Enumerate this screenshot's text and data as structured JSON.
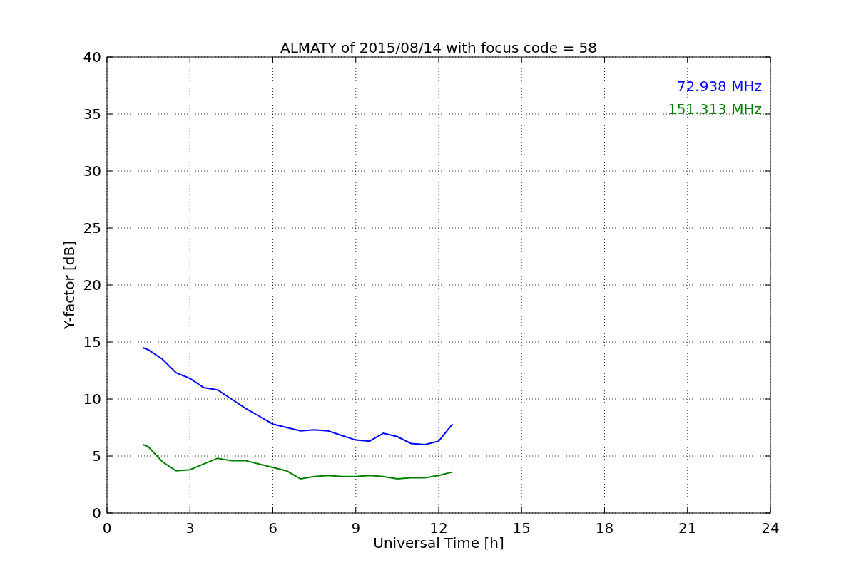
{
  "chart_data": {
    "type": "line",
    "title": "ALMATY of 2015/08/14 with focus code = 58",
    "xlabel": "Universal Time [h]",
    "ylabel": "Y-factor [dB]",
    "x": [
      1.3,
      1.5,
      2,
      2.5,
      3,
      3.5,
      4,
      4.5,
      5,
      5.5,
      6,
      6.5,
      7,
      7.5,
      8,
      8.5,
      9,
      9.5,
      10,
      10.5,
      11,
      11.5,
      12,
      12.5
    ],
    "series": [
      {
        "name": "72.938 MHz",
        "color": "#0000ff",
        "values": [
          14.5,
          14.3,
          13.5,
          12.3,
          11.8,
          11,
          10.8,
          10,
          9.2,
          8.5,
          7.8,
          7.5,
          7.2,
          7.3,
          7.2,
          6.8,
          6.4,
          6.3,
          7,
          6.7,
          6.1,
          6,
          6.3,
          7.8
        ]
      },
      {
        "name": "151.313 MHz",
        "color": "#008000",
        "values": [
          6,
          5.8,
          4.5,
          3.7,
          3.8,
          4.3,
          4.8,
          4.6,
          4.6,
          4.3,
          4,
          3.7,
          3,
          3.2,
          3.3,
          3.2,
          3.2,
          3.3,
          3.2,
          3,
          3.1,
          3.1,
          3.3,
          3.6
        ]
      }
    ],
    "xlim": [
      0,
      24
    ],
    "ylim": [
      0,
      40
    ],
    "xticks": [
      0,
      3,
      6,
      9,
      12,
      15,
      18,
      21,
      24
    ],
    "yticks": [
      0,
      5,
      10,
      15,
      20,
      25,
      30,
      35,
      40
    ],
    "grid": true
  }
}
